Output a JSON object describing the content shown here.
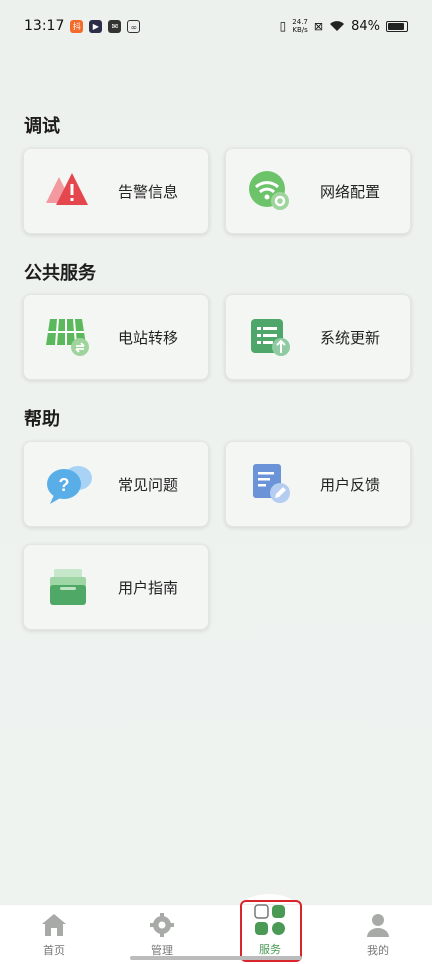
{
  "status_bar": {
    "time": "13:17",
    "network_speed": "24.7\nKB/s",
    "battery": "84%"
  },
  "sections": [
    {
      "title": "调试"
    },
    {
      "title": "公共服务"
    },
    {
      "title": "帮助"
    }
  ],
  "cards": {
    "alarm": "告警信息",
    "network": "网络配置",
    "station_transfer": "电站转移",
    "system_update": "系统更新",
    "faq": "常见问题",
    "feedback": "用户反馈",
    "guide": "用户指南"
  },
  "bottom_nav": {
    "home": "首页",
    "manage": "管理",
    "service": "服务",
    "mine": "我的",
    "active_color": "#4a9a55"
  }
}
